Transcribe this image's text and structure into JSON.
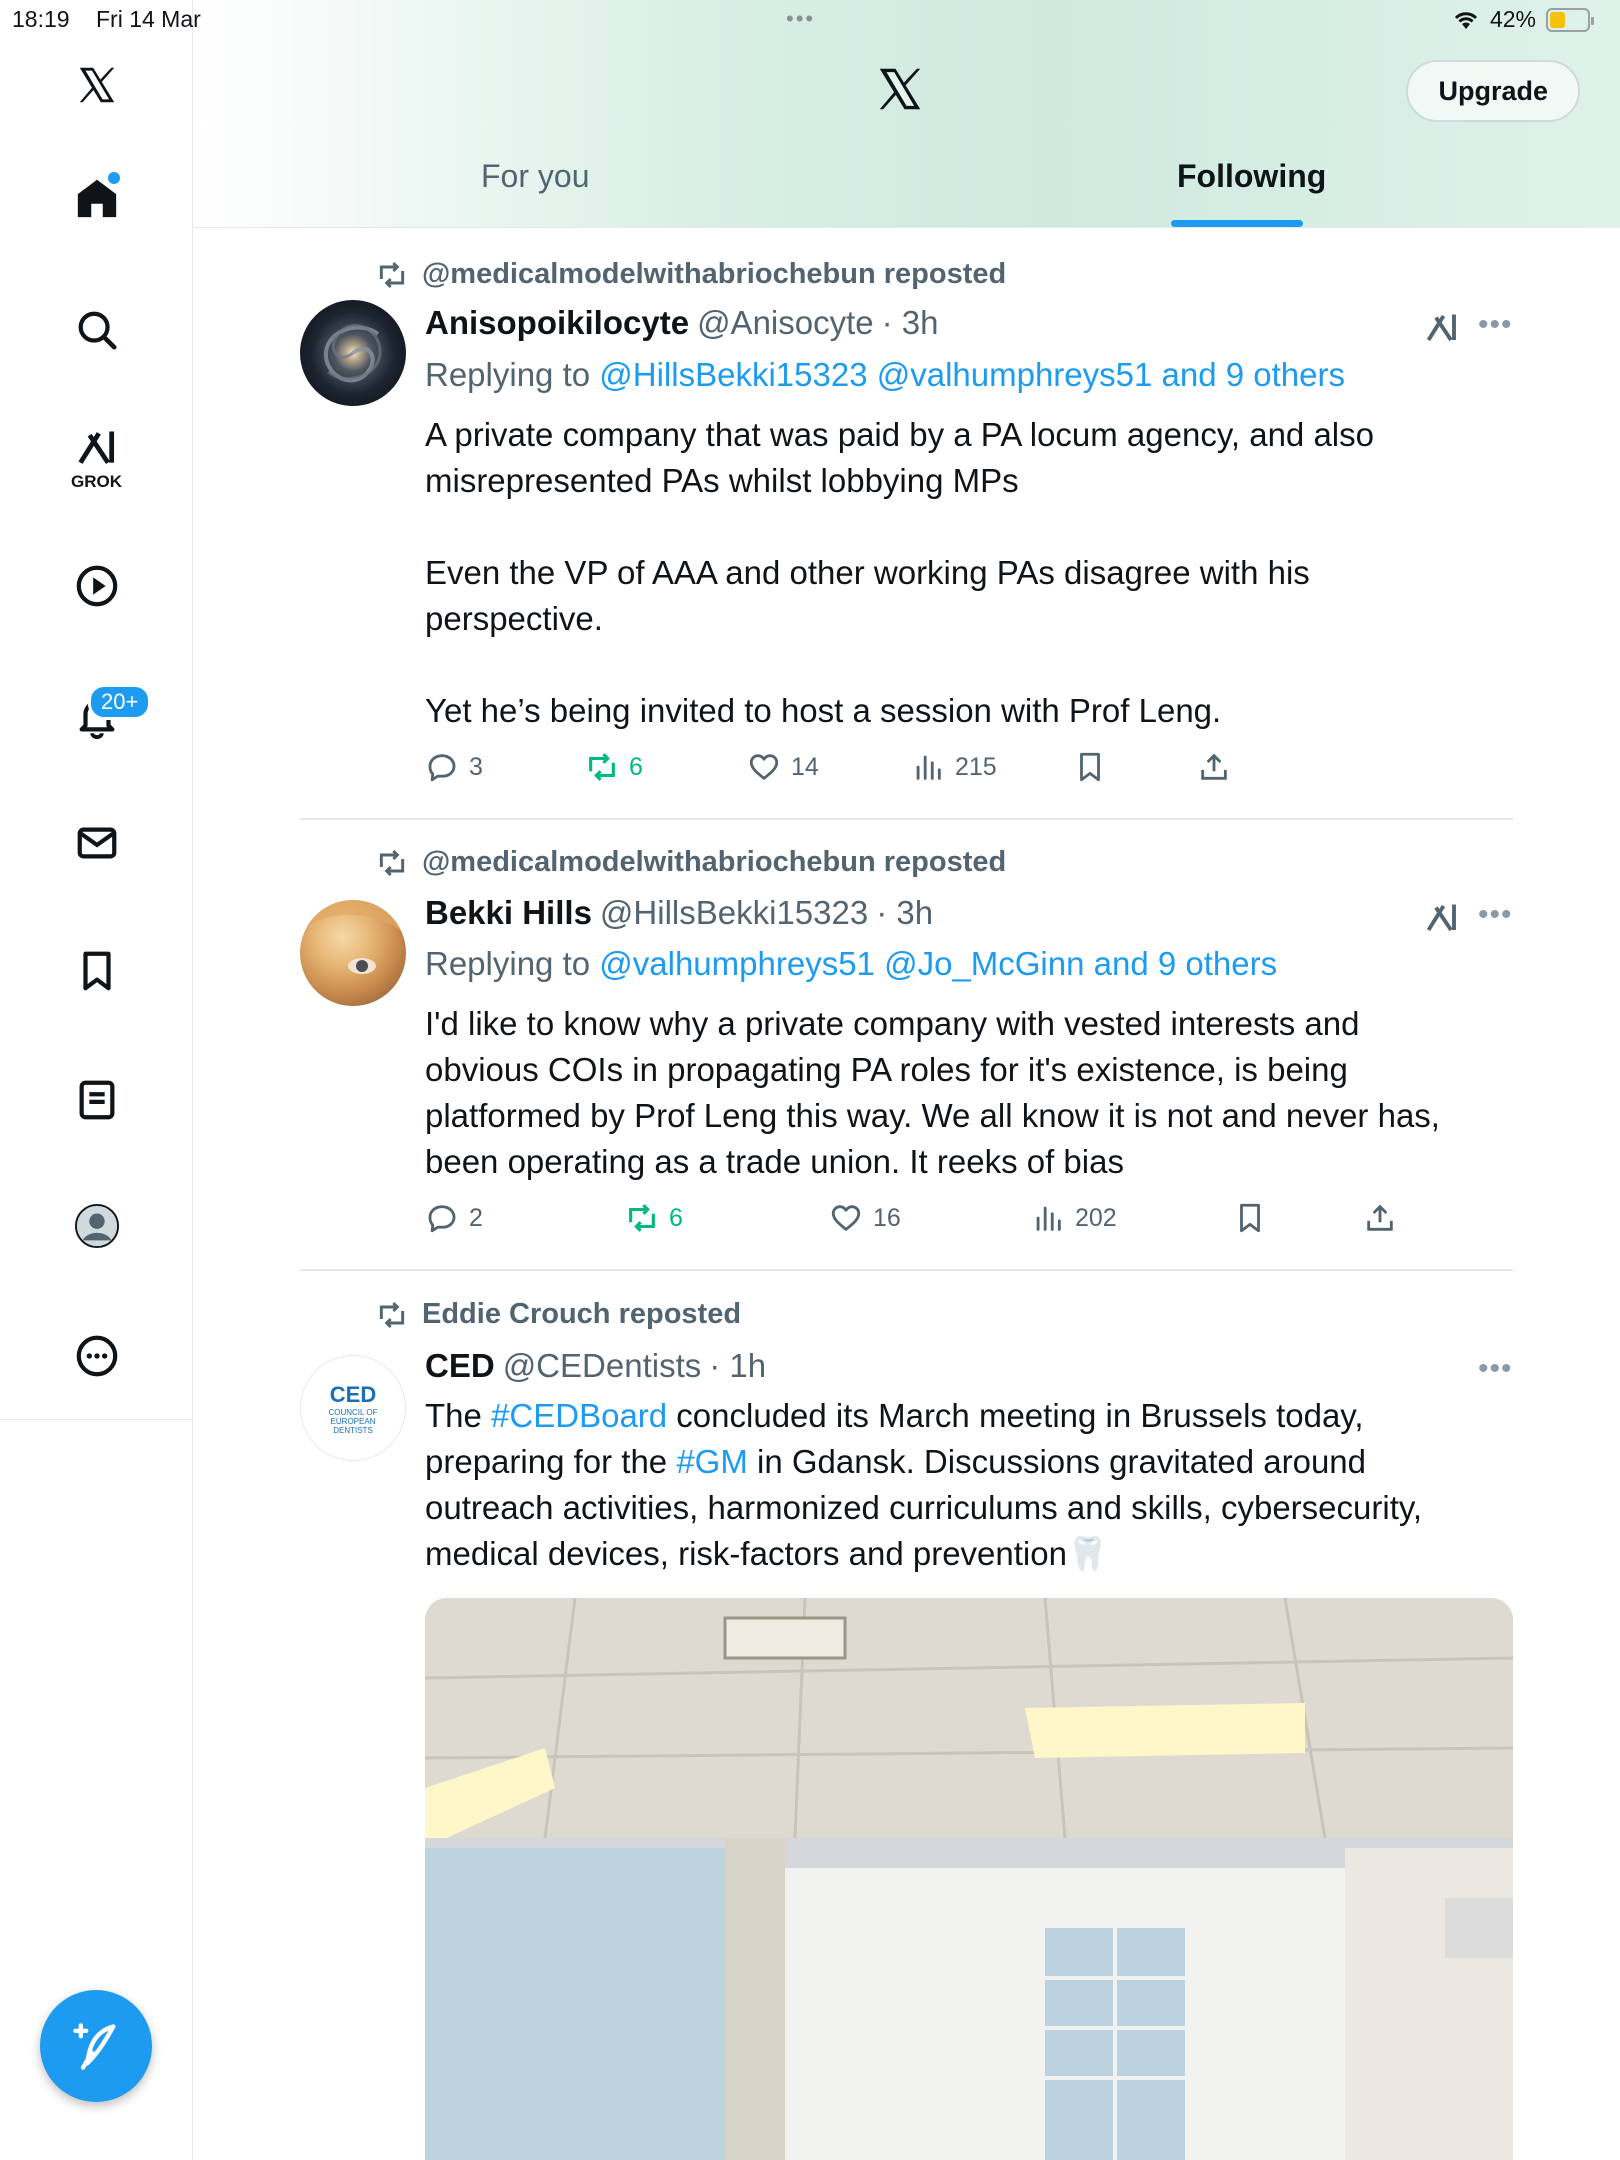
{
  "status_bar": {
    "time": "18:19",
    "date": "Fri 14 Mar",
    "battery": "42%"
  },
  "rail": {
    "grok_label": "GROK",
    "notifications_badge": "20+"
  },
  "header": {
    "upgrade_label": "Upgrade",
    "tabs": [
      {
        "label": "For you"
      },
      {
        "label": "Following"
      }
    ]
  },
  "tweets": [
    {
      "repost_by": "@medicalmodelwithabriochebun reposted",
      "name": "Anisopoikilocyte",
      "handle": "@Anisocyte",
      "time": "· 3h",
      "replying_prefix": "Replying to ",
      "replying_to": "@HillsBekki15323 @valhumphreys51 and 9 others",
      "text": "A private company that was paid by a PA locum agency, and also\nmisrepresented PAs whilst lobbying MPs\n\nEven the VP of AAA and other working PAs disagree with his\nperspective.\n\nYet he’s being invited to host a session with Prof Leng.",
      "replies": "3",
      "reposts": "6",
      "likes": "14",
      "views": "215"
    },
    {
      "repost_by": "@medicalmodelwithabriochebun reposted",
      "name": "Bekki Hills",
      "handle": "@HillsBekki15323",
      "time": "· 3h",
      "replying_prefix": "Replying to ",
      "replying_to": "@valhumphreys51 @Jo_McGinn and 9 others",
      "text": "I'd like to know why a private company with vested interests and\nobvious COIs in propagating PA roles for it's existence, is being\nplatformed by Prof Leng this way. We all know it is not and never has,\nbeen operating as a trade union. It reeks of bias",
      "replies": "2",
      "reposts": "6",
      "likes": "16",
      "views": "202"
    },
    {
      "repost_by": "Eddie Crouch reposted",
      "name": "CED",
      "handle": "@CEDentists",
      "time": "· 1h",
      "text_1": "The ",
      "tag_1": "#CEDBoard",
      "text_2": " concluded its March meeting in Brussels today,\npreparing for the ",
      "tag_2": "#GM",
      "text_3": " in Gdansk. Discussions gravitated around\noutreach activities, harmonized curriculums and skills, cybersecurity,\nmedical devices, risk-factors and prevention🦷",
      "avatar_text": "CED",
      "avatar_subtext": "COUNCIL OF EUROPEAN DENTISTS"
    }
  ],
  "colors": {
    "accent": "#1d9bf0",
    "repost_green": "#00ba7c",
    "muted": "#536471"
  }
}
